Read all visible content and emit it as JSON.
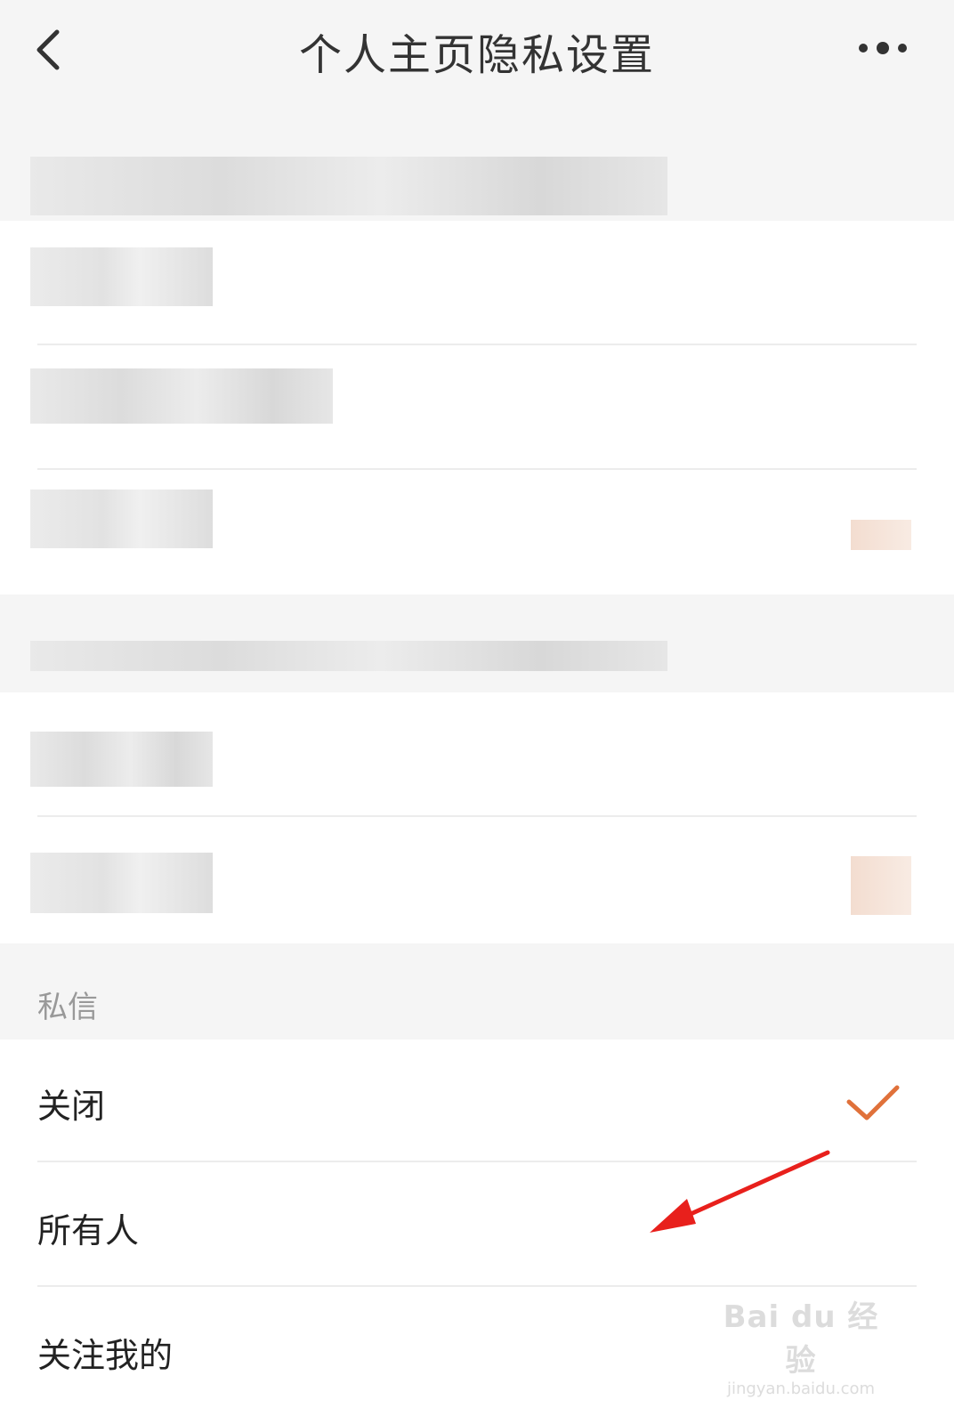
{
  "header": {
    "title": "个人主页隐私设置",
    "back_icon": "chevron-left-icon",
    "more_icon": "more-dots-icon"
  },
  "messages_section": {
    "label": "私信",
    "options": [
      {
        "label": "关闭",
        "selected": true
      },
      {
        "label": "所有人",
        "selected": false
      },
      {
        "label": "关注我的",
        "selected": false
      }
    ]
  },
  "watermark": {
    "main": "Bai du 经验",
    "sub": "jingyan.baidu.com"
  },
  "colors": {
    "accent": "#e0713a",
    "annotation_arrow": "#e8201c",
    "background": "#f5f5f5",
    "panel": "#ffffff"
  }
}
